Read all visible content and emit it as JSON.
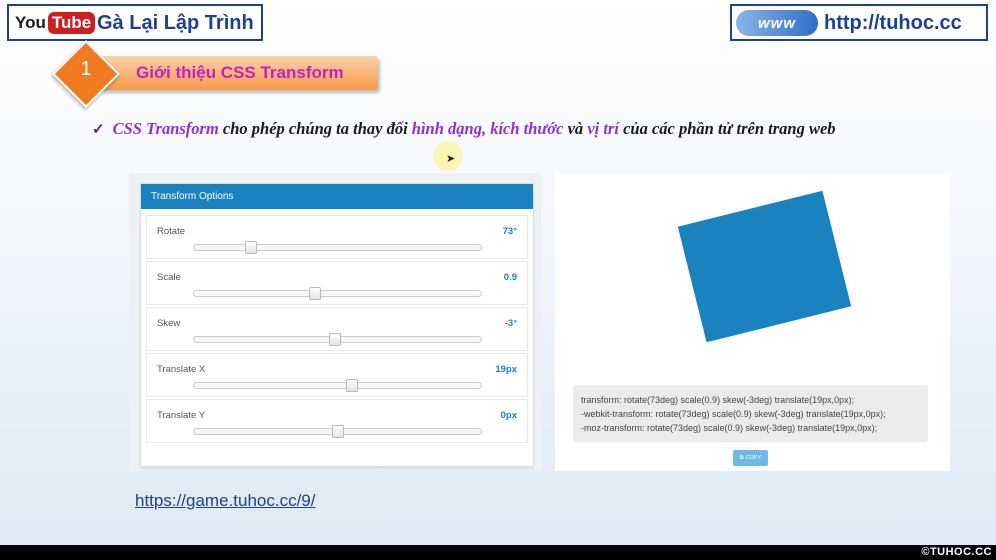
{
  "header": {
    "youtube_you": "You",
    "youtube_tube": "Tube",
    "channel_name": "Gà Lại Lập Trình",
    "www_badge": "www",
    "site_url": "http://tuhoc.cc"
  },
  "section": {
    "number": "1",
    "title": "Giới thiệu CSS Transform"
  },
  "bullet": {
    "part1": "CSS Transform",
    "part2": " cho phép chúng ta thay đổi ",
    "part3": "hình dạng, kích thước",
    "part4": " và ",
    "part5": "vị trí",
    "part6": " của các phần tử trên trang web"
  },
  "transform_options": {
    "title": "Transform Options",
    "rows": [
      {
        "label": "Rotate",
        "value": "73°",
        "slider_fraction": 0.2
      },
      {
        "label": "Scale",
        "value": "0.9",
        "slider_fraction": 0.42
      },
      {
        "label": "Skew",
        "value": "-3°",
        "slider_fraction": 0.49
      },
      {
        "label": "Translate X",
        "value": "19px",
        "slider_fraction": 0.55
      },
      {
        "label": "Translate Y",
        "value": "0px",
        "slider_fraction": 0.5
      }
    ]
  },
  "preview": {
    "code_lines": [
      "transform: rotate(73deg) scale(0.9) skew(-3deg) translate(19px,0px);",
      "-webkit-transform: rotate(73deg) scale(0.9) skew(-3deg) translate(19px,0px);",
      "-moz-transform: rotate(73deg) scale(0.9) skew(-3deg) translate(19px,0px);"
    ],
    "copy_label": "COPY"
  },
  "link": "https://game.tuhoc.cc/9/",
  "watermark": "TUHOC.CC",
  "colors": {
    "accent_blue": "#1a82be",
    "brand_navy": "#1f3f8f",
    "highlight_purple": "#8f2fd6",
    "section_orange": "#f07a1f"
  }
}
